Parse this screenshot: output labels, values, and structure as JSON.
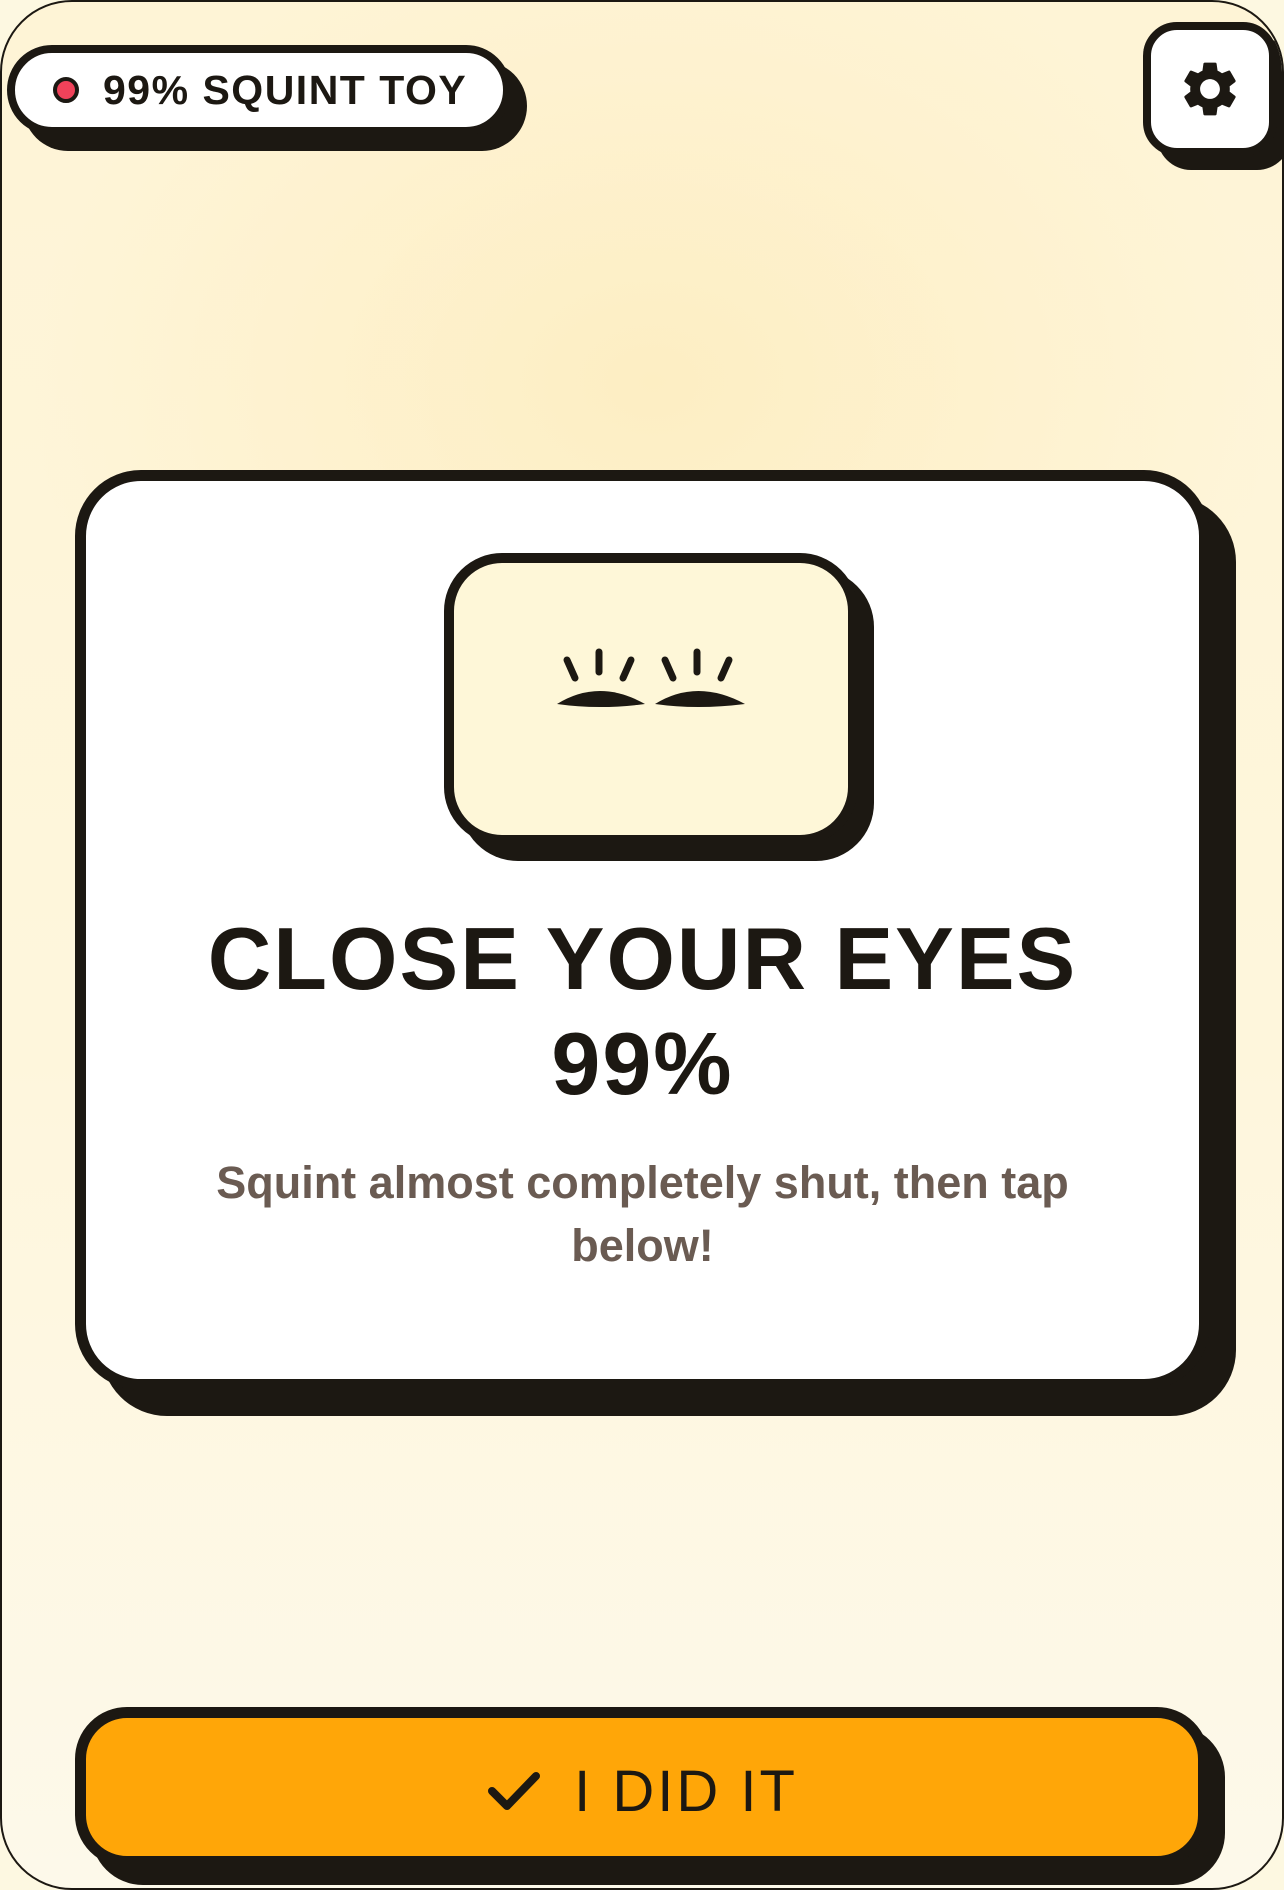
{
  "badge": {
    "label": "99% SQUINT TOY",
    "dot_color": "#f0425a"
  },
  "settings": {
    "icon": "gear-icon"
  },
  "card": {
    "icon": "squinting-eyes-icon",
    "title_line1": "CLOSE YOUR EYES",
    "title_line2": "99%",
    "subtitle": "Squint almost completely shut, then tap below!"
  },
  "action": {
    "icon": "checkmark-icon",
    "label": "I DID IT",
    "color": "#ffa608"
  },
  "colors": {
    "ink": "#1c1812",
    "background": "#fdf8e1",
    "card_background": "#ffffff",
    "icon_box_background": "#fef7d8",
    "subtitle_text": "#6a5b52"
  }
}
